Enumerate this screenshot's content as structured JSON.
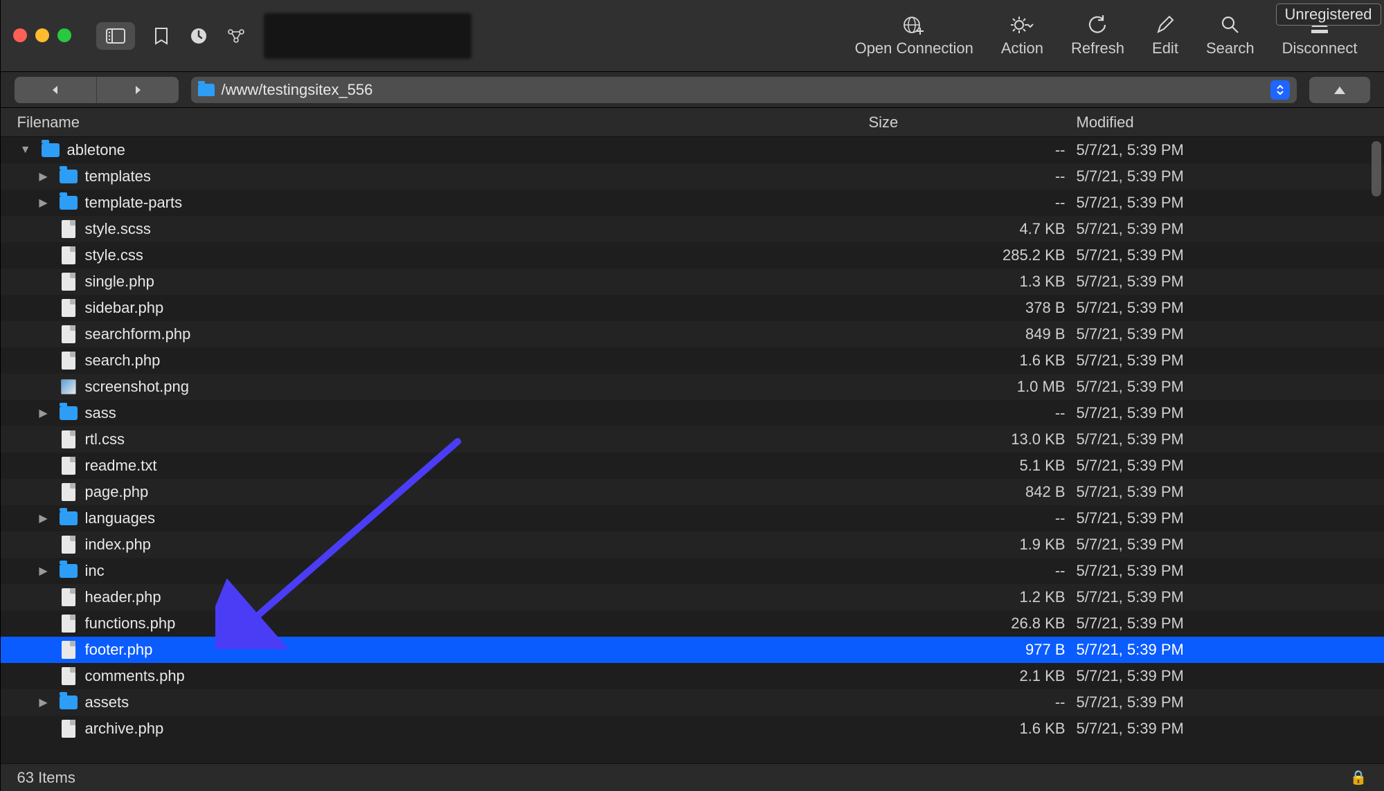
{
  "unregistered_label": "Unregistered",
  "toolbar": {
    "open_connection": "Open Connection",
    "action": "Action",
    "refresh": "Refresh",
    "edit": "Edit",
    "search": "Search",
    "disconnect": "Disconnect"
  },
  "path": "/www/testingsitex_556",
  "columns": {
    "filename": "Filename",
    "size": "Size",
    "modified": "Modified"
  },
  "rows": [
    {
      "indent": 1,
      "arrow": "down",
      "icon": "folder",
      "name": "abletone",
      "size": "--",
      "modified": "5/7/21, 5:39 PM",
      "selected": false
    },
    {
      "indent": 2,
      "arrow": "right",
      "icon": "folder",
      "name": "templates",
      "size": "--",
      "modified": "5/7/21, 5:39 PM",
      "selected": false
    },
    {
      "indent": 2,
      "arrow": "right",
      "icon": "folder",
      "name": "template-parts",
      "size": "--",
      "modified": "5/7/21, 5:39 PM",
      "selected": false
    },
    {
      "indent": 2,
      "arrow": "",
      "icon": "file",
      "name": "style.scss",
      "size": "4.7 KB",
      "modified": "5/7/21, 5:39 PM",
      "selected": false
    },
    {
      "indent": 2,
      "arrow": "",
      "icon": "file",
      "name": "style.css",
      "size": "285.2 KB",
      "modified": "5/7/21, 5:39 PM",
      "selected": false
    },
    {
      "indent": 2,
      "arrow": "",
      "icon": "file",
      "name": "single.php",
      "size": "1.3 KB",
      "modified": "5/7/21, 5:39 PM",
      "selected": false
    },
    {
      "indent": 2,
      "arrow": "",
      "icon": "file",
      "name": "sidebar.php",
      "size": "378 B",
      "modified": "5/7/21, 5:39 PM",
      "selected": false
    },
    {
      "indent": 2,
      "arrow": "",
      "icon": "file",
      "name": "searchform.php",
      "size": "849 B",
      "modified": "5/7/21, 5:39 PM",
      "selected": false
    },
    {
      "indent": 2,
      "arrow": "",
      "icon": "file",
      "name": "search.php",
      "size": "1.6 KB",
      "modified": "5/7/21, 5:39 PM",
      "selected": false
    },
    {
      "indent": 2,
      "arrow": "",
      "icon": "img",
      "name": "screenshot.png",
      "size": "1.0 MB",
      "modified": "5/7/21, 5:39 PM",
      "selected": false
    },
    {
      "indent": 2,
      "arrow": "right",
      "icon": "folder",
      "name": "sass",
      "size": "--",
      "modified": "5/7/21, 5:39 PM",
      "selected": false
    },
    {
      "indent": 2,
      "arrow": "",
      "icon": "file",
      "name": "rtl.css",
      "size": "13.0 KB",
      "modified": "5/7/21, 5:39 PM",
      "selected": false
    },
    {
      "indent": 2,
      "arrow": "",
      "icon": "file",
      "name": "readme.txt",
      "size": "5.1 KB",
      "modified": "5/7/21, 5:39 PM",
      "selected": false
    },
    {
      "indent": 2,
      "arrow": "",
      "icon": "file",
      "name": "page.php",
      "size": "842 B",
      "modified": "5/7/21, 5:39 PM",
      "selected": false
    },
    {
      "indent": 2,
      "arrow": "right",
      "icon": "folder",
      "name": "languages",
      "size": "--",
      "modified": "5/7/21, 5:39 PM",
      "selected": false
    },
    {
      "indent": 2,
      "arrow": "",
      "icon": "file",
      "name": "index.php",
      "size": "1.9 KB",
      "modified": "5/7/21, 5:39 PM",
      "selected": false
    },
    {
      "indent": 2,
      "arrow": "right",
      "icon": "folder",
      "name": "inc",
      "size": "--",
      "modified": "5/7/21, 5:39 PM",
      "selected": false
    },
    {
      "indent": 2,
      "arrow": "",
      "icon": "file",
      "name": "header.php",
      "size": "1.2 KB",
      "modified": "5/7/21, 5:39 PM",
      "selected": false
    },
    {
      "indent": 2,
      "arrow": "",
      "icon": "file",
      "name": "functions.php",
      "size": "26.8 KB",
      "modified": "5/7/21, 5:39 PM",
      "selected": false
    },
    {
      "indent": 2,
      "arrow": "",
      "icon": "file",
      "name": "footer.php",
      "size": "977 B",
      "modified": "5/7/21, 5:39 PM",
      "selected": true
    },
    {
      "indent": 2,
      "arrow": "",
      "icon": "file",
      "name": "comments.php",
      "size": "2.1 KB",
      "modified": "5/7/21, 5:39 PM",
      "selected": false
    },
    {
      "indent": 2,
      "arrow": "right",
      "icon": "folder",
      "name": "assets",
      "size": "--",
      "modified": "5/7/21, 5:39 PM",
      "selected": false
    },
    {
      "indent": 2,
      "arrow": "",
      "icon": "file",
      "name": "archive.php",
      "size": "1.6 KB",
      "modified": "5/7/21, 5:39 PM",
      "selected": false
    }
  ],
  "status": "63 Items",
  "annotation": {
    "arrow_color": "#4a3df5"
  }
}
